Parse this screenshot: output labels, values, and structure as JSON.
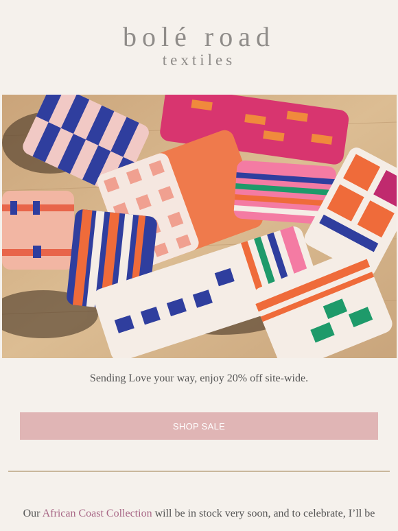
{
  "header": {
    "logo_main": "bolé road",
    "logo_sub": "textiles"
  },
  "hero": {
    "image_name": "pillows-hero-image"
  },
  "promo": {
    "text": "Sending Love your way, enjoy 20% off site-wide."
  },
  "cta": {
    "label": "SHOP SALE"
  },
  "body": {
    "prefix": "Our ",
    "link_text": "African Coast Collection",
    "suffix": " will be in stock very soon, and to celebrate, I’ll be"
  },
  "colors": {
    "background": "#f5f1ec",
    "cta_background": "#e0b5b5",
    "link": "#a86786",
    "divider": "#c9b79c"
  }
}
